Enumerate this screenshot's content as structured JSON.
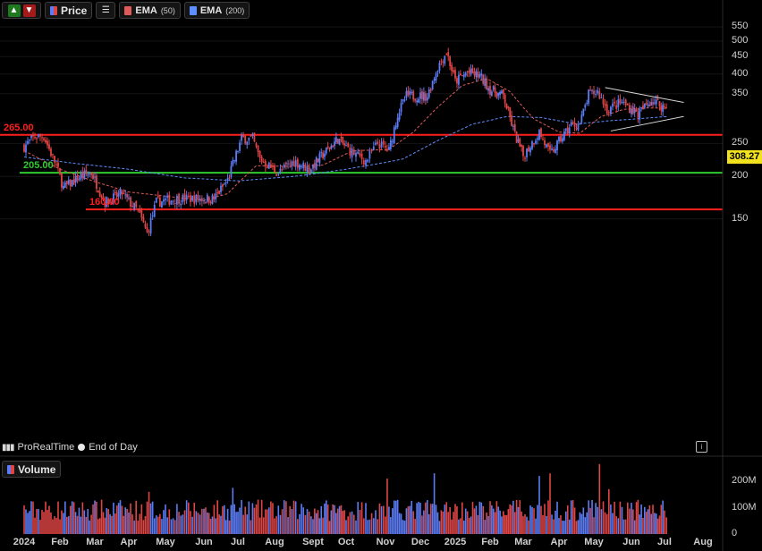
{
  "toolbar": {
    "price_label": "Price",
    "ema50_label": "EMA",
    "ema50_period": "(50)",
    "ema200_label": "EMA",
    "ema200_period": "(200)"
  },
  "footer": {
    "source": "ProRealTime",
    "period": "End of Day"
  },
  "volume_panel": {
    "label": "Volume"
  },
  "last_price": "308.27",
  "colors": {
    "up": "#5b7cf5",
    "down": "#e04545",
    "ema50": "#e05a5a",
    "ema200": "#5f8fff",
    "support_red": "#ff1f1f",
    "support_green": "#2fcc2f",
    "triangle": "#d8d8d8",
    "price_tag": "#f2e21e"
  },
  "chart_data": {
    "type": "candlestick",
    "y_ticks": [
      "550",
      "500",
      "450",
      "400",
      "350",
      "250",
      "200",
      "150"
    ],
    "y_scale": "log",
    "ylim": [
      130,
      550
    ],
    "x_ticks": [
      "2024",
      "Feb",
      "Mar",
      "Apr",
      "May",
      "Jun",
      "Jul",
      "Aug",
      "Sept",
      "Oct",
      "Nov",
      "Dec",
      "2025",
      "Feb",
      "Mar",
      "Apr",
      "May",
      "Jun",
      "Jul",
      "Aug"
    ],
    "x_range": [
      "2024-01",
      "2025-08"
    ],
    "levels": [
      {
        "label": "265.00",
        "value": 265,
        "color": "red"
      },
      {
        "label": "205.00",
        "value": 205,
        "color": "green"
      },
      {
        "label": "160.00",
        "value": 160,
        "color": "red"
      }
    ],
    "price_path": [
      {
        "t": 0.0,
        "v": 245
      },
      {
        "t": 0.3,
        "v": 262
      },
      {
        "t": 0.55,
        "v": 262
      },
      {
        "t": 0.9,
        "v": 215
      },
      {
        "t": 1.1,
        "v": 185
      },
      {
        "t": 1.6,
        "v": 200
      },
      {
        "t": 1.9,
        "v": 205
      },
      {
        "t": 2.3,
        "v": 168
      },
      {
        "t": 2.8,
        "v": 178
      },
      {
        "t": 3.25,
        "v": 158
      },
      {
        "t": 3.5,
        "v": 136
      },
      {
        "t": 3.75,
        "v": 168
      },
      {
        "t": 4.3,
        "v": 172
      },
      {
        "t": 5.3,
        "v": 172
      },
      {
        "t": 5.7,
        "v": 195
      },
      {
        "t": 6.1,
        "v": 258
      },
      {
        "t": 6.4,
        "v": 258
      },
      {
        "t": 6.6,
        "v": 225
      },
      {
        "t": 7.1,
        "v": 205
      },
      {
        "t": 7.5,
        "v": 222
      },
      {
        "t": 7.9,
        "v": 210
      },
      {
        "t": 8.3,
        "v": 232
      },
      {
        "t": 8.75,
        "v": 258
      },
      {
        "t": 9.1,
        "v": 238
      },
      {
        "t": 9.5,
        "v": 222
      },
      {
        "t": 9.8,
        "v": 250
      },
      {
        "t": 10.1,
        "v": 238
      },
      {
        "t": 10.35,
        "v": 305
      },
      {
        "t": 10.6,
        "v": 345
      },
      {
        "t": 11.2,
        "v": 345
      },
      {
        "t": 11.5,
        "v": 420
      },
      {
        "t": 11.75,
        "v": 465
      },
      {
        "t": 12.0,
        "v": 380
      },
      {
        "t": 12.35,
        "v": 405
      },
      {
        "t": 12.7,
        "v": 395
      },
      {
        "t": 13.0,
        "v": 360
      },
      {
        "t": 13.4,
        "v": 345
      },
      {
        "t": 13.75,
        "v": 265
      },
      {
        "t": 14.0,
        "v": 230
      },
      {
        "t": 14.45,
        "v": 270
      },
      {
        "t": 14.75,
        "v": 232
      },
      {
        "t": 15.1,
        "v": 262
      },
      {
        "t": 15.35,
        "v": 282
      },
      {
        "t": 15.6,
        "v": 285
      },
      {
        "t": 15.85,
        "v": 348
      },
      {
        "t": 16.1,
        "v": 355
      },
      {
        "t": 16.35,
        "v": 315
      },
      {
        "t": 16.75,
        "v": 330
      },
      {
        "t": 17.2,
        "v": 305
      },
      {
        "t": 17.6,
        "v": 335
      },
      {
        "t": 18.05,
        "v": 318
      },
      {
        "t": 18.1,
        "v": 308
      }
    ],
    "ema50_path": [
      {
        "t": 0.0,
        "v": 238
      },
      {
        "t": 1.0,
        "v": 210
      },
      {
        "t": 2.0,
        "v": 193
      },
      {
        "t": 3.0,
        "v": 180
      },
      {
        "t": 4.0,
        "v": 175
      },
      {
        "t": 5.0,
        "v": 170
      },
      {
        "t": 5.7,
        "v": 178
      },
      {
        "t": 6.5,
        "v": 215
      },
      {
        "t": 7.5,
        "v": 214
      },
      {
        "t": 8.3,
        "v": 216
      },
      {
        "t": 9.2,
        "v": 238
      },
      {
        "t": 10.1,
        "v": 240
      },
      {
        "t": 10.8,
        "v": 270
      },
      {
        "t": 11.5,
        "v": 320
      },
      {
        "t": 12.2,
        "v": 370
      },
      {
        "t": 12.9,
        "v": 388
      },
      {
        "t": 13.6,
        "v": 355
      },
      {
        "t": 14.3,
        "v": 295
      },
      {
        "t": 15.0,
        "v": 270
      },
      {
        "t": 15.6,
        "v": 268
      },
      {
        "t": 16.2,
        "v": 300
      },
      {
        "t": 16.8,
        "v": 315
      },
      {
        "t": 17.5,
        "v": 318
      },
      {
        "t": 18.1,
        "v": 317
      }
    ],
    "ema200_path": [
      {
        "t": 0.0,
        "v": 228
      },
      {
        "t": 1.5,
        "v": 218
      },
      {
        "t": 3.0,
        "v": 210
      },
      {
        "t": 4.5,
        "v": 198
      },
      {
        "t": 6.0,
        "v": 194
      },
      {
        "t": 7.5,
        "v": 200
      },
      {
        "t": 9.0,
        "v": 210
      },
      {
        "t": 10.5,
        "v": 225
      },
      {
        "t": 11.5,
        "v": 255
      },
      {
        "t": 12.5,
        "v": 285
      },
      {
        "t": 13.5,
        "v": 300
      },
      {
        "t": 14.5,
        "v": 298
      },
      {
        "t": 15.5,
        "v": 285
      },
      {
        "t": 16.5,
        "v": 292
      },
      {
        "t": 17.5,
        "v": 297
      },
      {
        "t": 18.1,
        "v": 300
      }
    ],
    "triangle": {
      "upper": [
        {
          "t": 16.3,
          "v": 365
        },
        {
          "t": 18.5,
          "v": 330
        }
      ],
      "lower": [
        {
          "t": 16.45,
          "v": 272
        },
        {
          "t": 18.5,
          "v": 300
        }
      ]
    },
    "volume": {
      "y_ticks": [
        "200M",
        "100M",
        "0"
      ],
      "ylim": [
        0,
        280
      ],
      "avg": 90,
      "spikes": [
        {
          "t": 3.55,
          "v": 160
        },
        {
          "t": 5.85,
          "v": 175
        },
        {
          "t": 10.05,
          "v": 210
        },
        {
          "t": 11.4,
          "v": 230
        },
        {
          "t": 14.45,
          "v": 220
        },
        {
          "t": 14.75,
          "v": 230
        },
        {
          "t": 16.15,
          "v": 265
        },
        {
          "t": 16.4,
          "v": 170
        }
      ]
    }
  }
}
